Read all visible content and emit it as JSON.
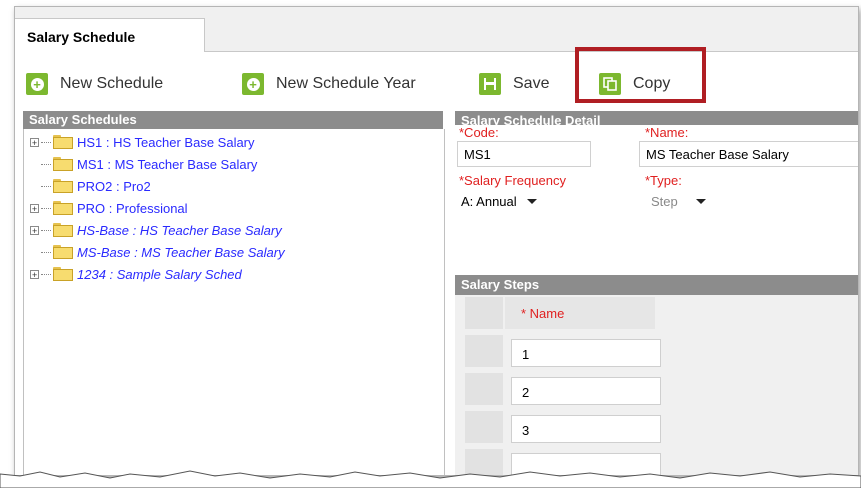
{
  "tab": {
    "label": "Salary Schedule"
  },
  "toolbar": {
    "new_schedule": "New Schedule",
    "new_schedule_year": "New Schedule Year",
    "save": "Save",
    "copy": "Copy"
  },
  "left_panel": {
    "header": "Salary Schedules",
    "items": [
      {
        "label": "HS1 : HS Teacher Base Salary",
        "expandable": true,
        "italic": false
      },
      {
        "label": "MS1 : MS Teacher Base Salary",
        "expandable": false,
        "italic": false
      },
      {
        "label": "PRO2 : Pro2",
        "expandable": false,
        "italic": false
      },
      {
        "label": "PRO : Professional",
        "expandable": true,
        "italic": false
      },
      {
        "label": "HS-Base : HS Teacher Base Salary",
        "expandable": true,
        "italic": true
      },
      {
        "label": "MS-Base : MS Teacher Base Salary",
        "expandable": false,
        "italic": true
      },
      {
        "label": "1234 : Sample Salary Sched",
        "expandable": true,
        "italic": true
      }
    ]
  },
  "detail": {
    "header": "Salary Schedule Detail",
    "code_label": "*Code:",
    "code_value": "MS1",
    "name_label": "*Name:",
    "name_value": "MS Teacher Base Salary",
    "freq_label": "*Salary Frequency",
    "freq_value": "A: Annual",
    "type_label": "*Type:",
    "type_value": "Step"
  },
  "steps": {
    "header": "Salary Steps",
    "name_col": "* Name",
    "rows": [
      "1",
      "2",
      "3",
      ""
    ]
  },
  "colors": {
    "accent_green": "#7cb82f",
    "highlight_red": "#b01e23",
    "link_blue": "#2a2aff",
    "required_red": "#e02020"
  }
}
